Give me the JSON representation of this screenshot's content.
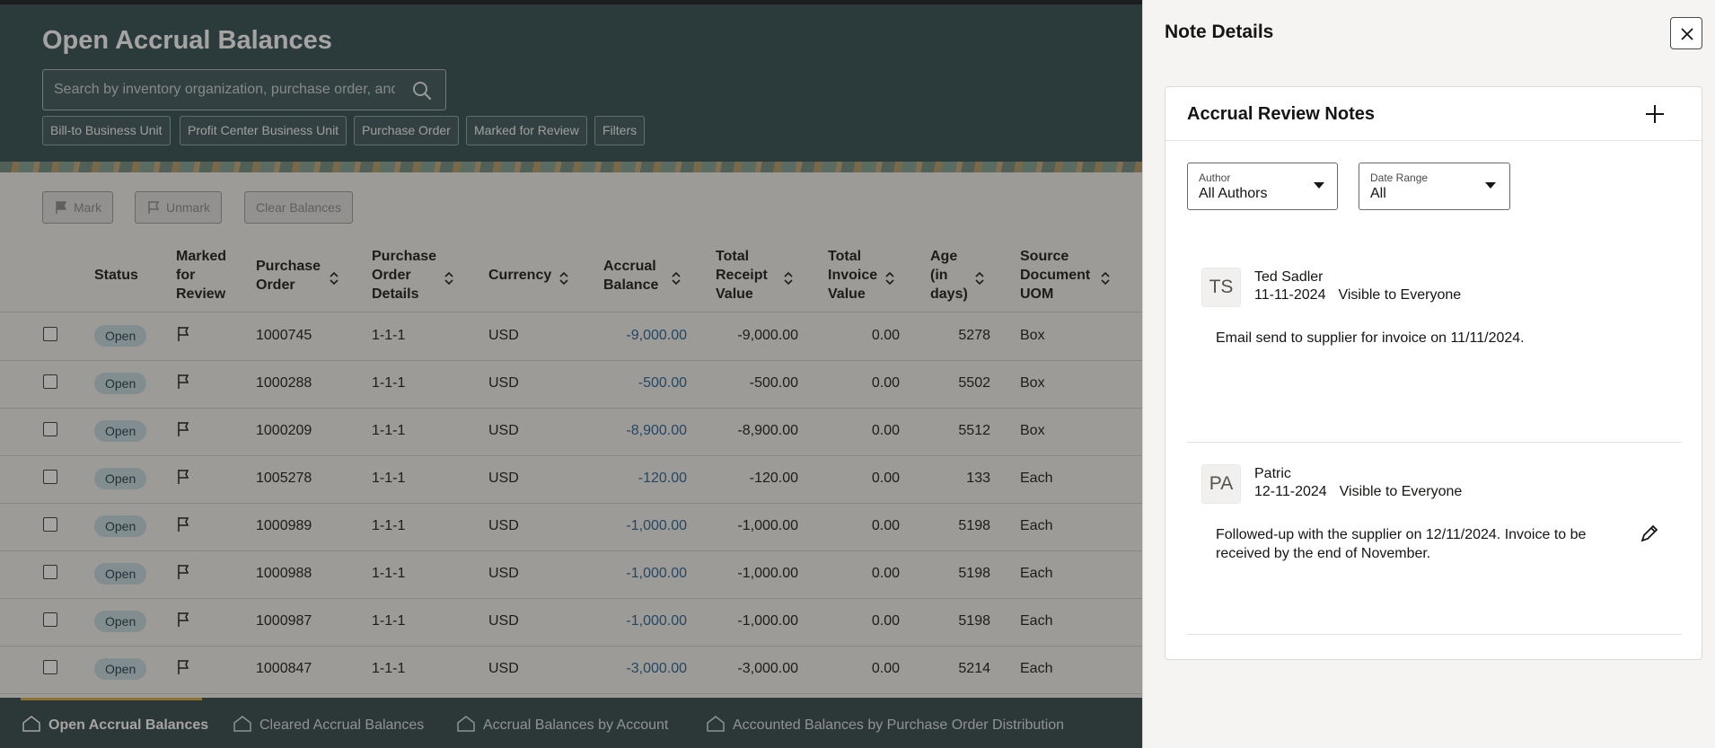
{
  "page": {
    "title": "Open Accrual Balances",
    "search_placeholder": "Search by inventory organization, purchase order, and more"
  },
  "filters": [
    "Bill-to Business Unit",
    "Profit Center Business Unit",
    "Purchase Order",
    "Marked for Review",
    "Filters"
  ],
  "toolbar": {
    "mark_label": "Mark",
    "unmark_label": "Unmark",
    "clear_label": "Clear Balances"
  },
  "table": {
    "headers": {
      "status": "Status",
      "marked": [
        "Marked",
        "for",
        "Review"
      ],
      "po": [
        "Purchase",
        "Order"
      ],
      "po_details": [
        "Purchase",
        "Order",
        "Details"
      ],
      "currency": "Currency",
      "accrual": [
        "Accrual",
        "Balance"
      ],
      "receipt": [
        "Total",
        "Receipt",
        "Value"
      ],
      "invoice": [
        "Total",
        "Invoice",
        "Value"
      ],
      "age": [
        "Age",
        "(in",
        "days)"
      ],
      "uom": [
        "Source",
        "Document",
        "UOM"
      ]
    },
    "rows": [
      {
        "status": "Open",
        "po": "1000745",
        "details": "1-1-1",
        "currency": "USD",
        "accrual": "-9,000.00",
        "receipt": "-9,000.00",
        "invoice": "0.00",
        "age": "5278",
        "uom": "Box"
      },
      {
        "status": "Open",
        "po": "1000288",
        "details": "1-1-1",
        "currency": "USD",
        "accrual": "-500.00",
        "receipt": "-500.00",
        "invoice": "0.00",
        "age": "5502",
        "uom": "Box"
      },
      {
        "status": "Open",
        "po": "1000209",
        "details": "1-1-1",
        "currency": "USD",
        "accrual": "-8,900.00",
        "receipt": "-8,900.00",
        "invoice": "0.00",
        "age": "5512",
        "uom": "Box"
      },
      {
        "status": "Open",
        "po": "1005278",
        "details": "1-1-1",
        "currency": "USD",
        "accrual": "-120.00",
        "receipt": "-120.00",
        "invoice": "0.00",
        "age": "133",
        "uom": "Each"
      },
      {
        "status": "Open",
        "po": "1000989",
        "details": "1-1-1",
        "currency": "USD",
        "accrual": "-1,000.00",
        "receipt": "-1,000.00",
        "invoice": "0.00",
        "age": "5198",
        "uom": "Each"
      },
      {
        "status": "Open",
        "po": "1000988",
        "details": "1-1-1",
        "currency": "USD",
        "accrual": "-1,000.00",
        "receipt": "-1,000.00",
        "invoice": "0.00",
        "age": "5198",
        "uom": "Each"
      },
      {
        "status": "Open",
        "po": "1000987",
        "details": "1-1-1",
        "currency": "USD",
        "accrual": "-1,000.00",
        "receipt": "-1,000.00",
        "invoice": "0.00",
        "age": "5198",
        "uom": "Each"
      },
      {
        "status": "Open",
        "po": "1000847",
        "details": "1-1-1",
        "currency": "USD",
        "accrual": "-3,000.00",
        "receipt": "-3,000.00",
        "invoice": "0.00",
        "age": "5214",
        "uom": "Each"
      }
    ]
  },
  "bottom_nav": [
    {
      "label": "Open Accrual Balances",
      "active": true
    },
    {
      "label": "Cleared Accrual Balances",
      "active": false
    },
    {
      "label": "Accrual Balances by Account",
      "active": false
    },
    {
      "label": "Accounted Balances by Purchase Order Distribution",
      "active": false
    }
  ],
  "drawer": {
    "title": "Note Details",
    "card_title": "Accrual Review Notes",
    "author_filter": {
      "label": "Author",
      "value": "All Authors"
    },
    "date_filter": {
      "label": "Date Range",
      "value": "All"
    },
    "notes": [
      {
        "initials": "TS",
        "author": "Ted Sadler",
        "date": "11-11-2024",
        "visibility": "Visible to Everyone",
        "text": "Email send to supplier for invoice on 11/11/2024.",
        "editable": false
      },
      {
        "initials": "PA",
        "author": "Patric",
        "date": "12-11-2024",
        "visibility": "Visible to Everyone",
        "text": "Followed-up with the supplier on 12/11/2024. Invoice to be received by the end of November.",
        "editable": true
      }
    ]
  },
  "colors": {
    "header": "#2e4a4d",
    "link": "#1f5f8f",
    "badge": "#c3d7dd",
    "nav": "#2f4447",
    "active_tab": "#d7a93d"
  },
  "icons": {
    "search": "search-icon",
    "close": "close-icon",
    "add": "plus-icon",
    "edit": "pencil-icon",
    "flag": "flag-icon",
    "home": "home-icon",
    "caret": "chevron-down-icon",
    "sort": "sort-icon"
  }
}
